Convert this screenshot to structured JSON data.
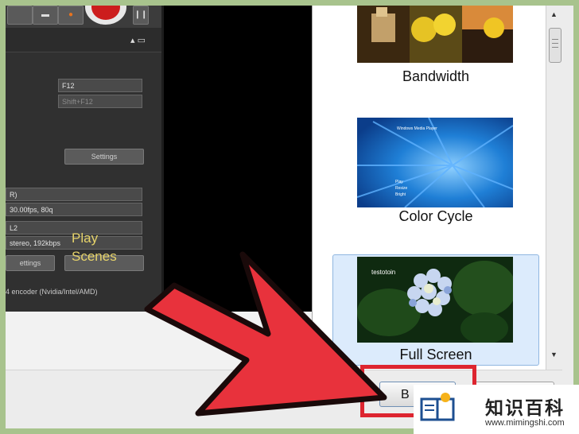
{
  "app": {
    "hotkey_primary": "F12",
    "hotkey_secondary": "Shift+F12",
    "settings_button": "Settings",
    "row1": "R)",
    "row2": "30.00fps, 80q",
    "row3": "L2",
    "row4": "stereo, 192kbps",
    "settings2_button": "ettings",
    "encoder_text": "4 encoder (Nvidia/Intel/AMD)",
    "overlay_play": "Play",
    "overlay_scenes": "Scenes"
  },
  "gallery": {
    "items": [
      {
        "label": "Bandwidth"
      },
      {
        "label": "Color Cycle",
        "caption": "Windows Media Player",
        "menu": [
          "Play",
          "Resize",
          "Bright"
        ]
      },
      {
        "label": "Full Screen",
        "caption": "testotoin",
        "selected": true
      }
    ]
  },
  "browse_button": "B",
  "watermark": {
    "title": "知识百科",
    "url": "www.mimingshi.com"
  },
  "colors": {
    "arrow_red": "#e8323c",
    "highlight_red": "#dd2530",
    "selected_bg": "#dcebfc"
  }
}
